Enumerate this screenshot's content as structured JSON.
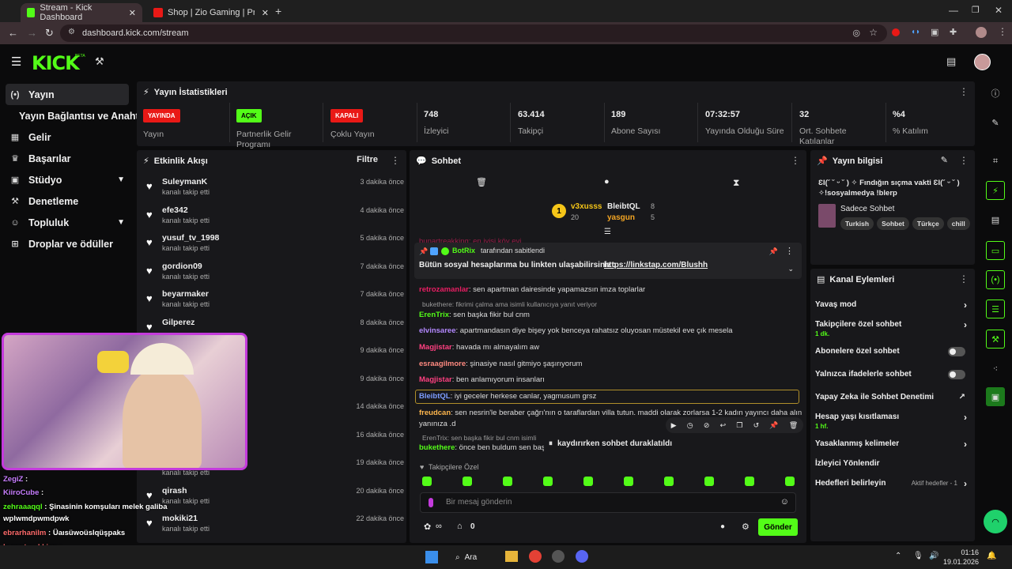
{
  "browser": {
    "tabs": [
      {
        "title": "Stream - Kick Dashboard"
      },
      {
        "title": "Shop | Zio Gaming | Premium G"
      }
    ],
    "url": "dashboard.kick.com/stream"
  },
  "kick": {
    "logo": "KICK",
    "beta": "BETA"
  },
  "sidebar": {
    "items": [
      {
        "label": "Yayın",
        "icon": "stream-icon"
      },
      {
        "label": "Yayın Bağlantısı ve Anahtarı",
        "icon": ""
      },
      {
        "label": "Gelir",
        "icon": "revenue-icon"
      },
      {
        "label": "Başarılar",
        "icon": "trophy-icon"
      },
      {
        "label": "Stüdyo",
        "icon": "studio-icon"
      },
      {
        "label": "Denetleme",
        "icon": "moderation-icon"
      },
      {
        "label": "Topluluk",
        "icon": "community-icon"
      },
      {
        "label": "Droplar ve ödüller",
        "icon": "drops-icon"
      }
    ]
  },
  "stats": {
    "title": "Yayın İstatistikleri",
    "items": [
      {
        "badge": "YAYINDA",
        "badge_color": "#e91916",
        "label": "Yayın"
      },
      {
        "badge": "AÇIK",
        "badge_color": "#53fc18",
        "label": "Partnerlik Gelir Programı"
      },
      {
        "badge": "KAPALI",
        "badge_color": "#e91916",
        "label": "Çoklu Yayın"
      },
      {
        "value": "748",
        "label": "İzleyici"
      },
      {
        "value": "63.414",
        "label": "Takipçi"
      },
      {
        "value": "189",
        "label": "Abone Sayısı"
      },
      {
        "value": "07:32:57",
        "label": "Yayında Olduğu Süre"
      },
      {
        "value": "32",
        "label": "Ort. Sohbete Katılanlar"
      },
      {
        "value": "%4",
        "label": "% Katılım"
      }
    ]
  },
  "activity": {
    "title": "Etkinlik Akışı",
    "filter": "Filtre",
    "rows": [
      {
        "name": "SuleymanK",
        "sub": "kanalı takip etti",
        "time": "3 dakika önce"
      },
      {
        "name": "efe342",
        "sub": "kanalı takip etti",
        "time": "4 dakika önce"
      },
      {
        "name": "yusuf_tv_1998",
        "sub": "kanalı takip etti",
        "time": "5 dakika önce"
      },
      {
        "name": "gordion09",
        "sub": "kanalı takip etti",
        "time": "7 dakika önce"
      },
      {
        "name": "beyarmaker",
        "sub": "kanalı takip etti",
        "time": "7 dakika önce"
      },
      {
        "name": "Gilperez",
        "sub": "",
        "time": "8 dakika önce"
      },
      {
        "name": "",
        "sub": "",
        "time": "9 dakika önce"
      },
      {
        "name": "uz",
        "sub": "",
        "time": "9 dakika önce"
      },
      {
        "name": "",
        "sub": "",
        "time": "14 dakika önce"
      },
      {
        "name": "",
        "sub": "",
        "time": "16 dakika önce"
      },
      {
        "name": "",
        "sub": "kanalı takip etti",
        "time": "19 dakika önce"
      },
      {
        "name": "qirash",
        "sub": "kanalı takip etti",
        "time": "20 dakika önce"
      },
      {
        "name": "mokiki21",
        "sub": "kanalı takip etti",
        "time": "22 dakika önce"
      }
    ]
  },
  "chat": {
    "title": "Sohbet",
    "top": {
      "user1": "v3xusss",
      "user1_count": "20",
      "user2": "BleibtQL",
      "user2_count": "8",
      "user3": "yasgun",
      "user3_count": "5",
      "rank": "1"
    },
    "cut_msg": "bunartreakking: en iyisi köy evi",
    "pinned": {
      "by": "BotRix",
      "by_suffix": "tarafından sabitlendi",
      "text": "Bütün sosyal hesaplarıma bu linkten ulaşabilirsiniz :",
      "link": "https://linkstap.com/Blushh"
    },
    "messages": [
      {
        "user": "retrozamanlar",
        "color": "#e91e63",
        "text": ": sen apartman dairesinde yapamazsın imza toplarlar"
      },
      {
        "user": "",
        "color": "#999",
        "text": "bukethere: fikrimi çalma ama  isimli kullanıcıya yanıt veriyor"
      },
      {
        "user": "ErenTrix",
        "color": "#53fc18",
        "text": ": sen başka fikir bul cnm"
      },
      {
        "user": "elvinsaree",
        "color": "#b388ff",
        "text": ": apartmandasın diye bişey yok benceya rahatsız oluyosan müstekil eve çık mesela"
      },
      {
        "user": "Magjistar",
        "color": "#ff4081",
        "text": ": havada mı almayalım aw"
      },
      {
        "user": "esraagilmore",
        "color": "#ff8a80",
        "text": ": şinasiye nasıl gitmiyo şaşırıyorum"
      },
      {
        "user": "Magjistar",
        "color": "#ff4081",
        "text": ": ben anlamıyorum insanları"
      },
      {
        "user": "BleibtQL",
        "color": "#7c9cff",
        "text": ": iyi geceler herkese canlar, yagmusum grsz"
      },
      {
        "user": "freudcan",
        "color": "#ffb74d",
        "text": ": sen nesrin'le beraber çağrı'nın o taraflardan villa tutun. maddi olarak zorlarsa 1-2 kadın yayıncı daha alın"
      },
      {
        "user": "",
        "color": "#ddd",
        "text": "yanınıza .d"
      },
      {
        "user": "",
        "color": "#999",
        "text": "ErenTrix: sen başka fikir bul cnm isimli"
      },
      {
        "user": "bukethere",
        "color": "#53fc18",
        "text": ": önce ben buldum sen başk"
      }
    ],
    "paused": "kaydırırken sohbet duraklatıldı",
    "followers_only": "Takipçilere Özel",
    "input_placeholder": "Bir mesaj gönderin",
    "points": "0",
    "send": "Gönder"
  },
  "stream_info": {
    "title": "Yayın bilgisi",
    "stream_title": "ƐƖ(˘ ˘ ᵕ ˘ ) ✧ Fındığın sıçma vakti ƐƖ(˘ ᵕ ˘ ) ✧!sosyalmedya !blerp",
    "category": "Sadece Sohbet",
    "tags": [
      "Turkish",
      "Sohbet",
      "Türkçe",
      "chill"
    ]
  },
  "channel_actions": {
    "title": "Kanal Eylemleri",
    "rows": [
      {
        "label": "Yavaş mod",
        "control": "arrow"
      },
      {
        "label": "Takipçilere özel sohbet",
        "sub": "1 dk.",
        "control": "arrow"
      },
      {
        "label": "Abonelere özel sohbet",
        "control": "toggle"
      },
      {
        "label": "Yalnızca ifadelerle sohbet",
        "control": "toggle"
      },
      {
        "label": "Yapay Zeka ile Sohbet Denetimi",
        "control": "external"
      },
      {
        "label": "Hesap yaşı kısıtlaması",
        "sub": "1 hf.",
        "control": "arrow"
      },
      {
        "label": "Yasaklanmış kelimeler",
        "control": "arrow"
      },
      {
        "label": "İzleyici Yönlendir",
        "control": ""
      },
      {
        "label": "Hedefleri belirleyin",
        "extra": "Aktif hedefler - 1",
        "control": "arrow"
      }
    ]
  },
  "overlay_chat": [
    {
      "user": "ZegiZ",
      "color": "#c77dff",
      "text": " : "
    },
    {
      "user": "KiiroCube",
      "color": "#c77dff",
      "text": " : "
    },
    {
      "user": "zehraaaqql",
      "color": "#53fc18",
      "text": " : Şinasinin komşuları melek galiba"
    },
    {
      "user": "",
      "color": "#fff",
      "text": "wplwmdpwmdpwk"
    },
    {
      "user": "ebrarhanilm",
      "color": "#ff6b6b",
      "text": " : Üaısüwoüslqüşpaks"
    },
    {
      "user": "bunartreakking",
      "color": "#ff6b6b",
      "text": " : "
    },
    {
      "user": "esraagilmore",
      "color": "#ff8a80",
      "text": " : şldkfbljşdfcjbjfdclgbmcf"
    }
  ],
  "taskbar": {
    "search": "Ara",
    "time": "01:16",
    "date": "19.01.2026"
  }
}
